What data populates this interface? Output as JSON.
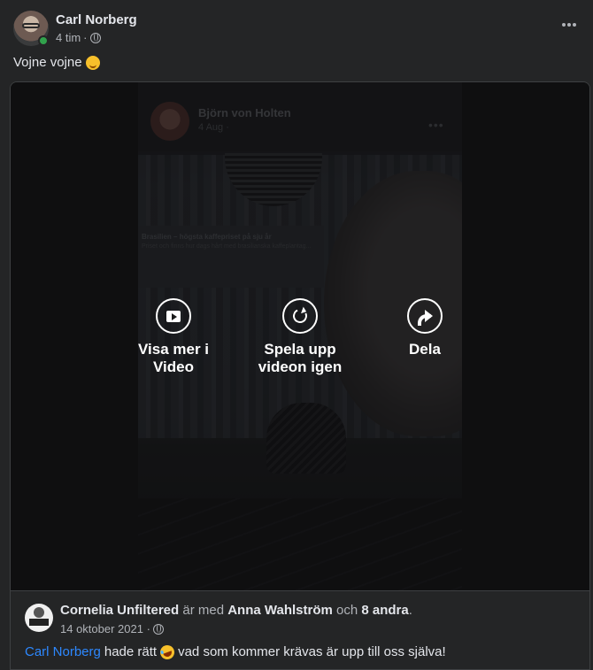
{
  "post": {
    "author": "Carl Norberg",
    "time": "4 tim",
    "separator": "·",
    "privacy_icon": "globe-icon",
    "more_icon": "more-horizontal-icon",
    "text": "Vojne vojne",
    "text_emoji": "winking-face-emoji",
    "online": true
  },
  "video": {
    "embedded_header": {
      "name": "Björn von Holten",
      "date": "4 Aug ·",
      "dots": "•••"
    },
    "screen_caption": "Brasilien – högsta kaffepriset på sju år",
    "screen_subcaption": "Priset och finns hur dags hårt med brasilianska kaffeplantag...",
    "actions": [
      {
        "icon": "video-play-icon",
        "label": "Visa mer i Video"
      },
      {
        "icon": "replay-icon",
        "label": "Spela upp videon igen"
      },
      {
        "icon": "share-icon",
        "label": "Dela"
      }
    ]
  },
  "original_post": {
    "author": "Cornelia Unfiltered",
    "with_text": "är med",
    "tagged": "Anna Wahlström",
    "and_text": "och",
    "others": "8 andra",
    "period": ".",
    "date": "14 oktober 2021 ·",
    "privacy_icon": "globe-icon",
    "mention": "Carl Norberg",
    "text_before_emoji": "hade rätt",
    "text_emoji": "rolling-on-floor-laughing-emoji",
    "text_after_emoji": "vad som kommer krävas är upp till oss själva!"
  },
  "colors": {
    "background": "#242526",
    "primary_text": "#e4e6eb",
    "secondary_text": "#b0b3b8",
    "link": "#2d88ff",
    "online": "#31a24c"
  }
}
